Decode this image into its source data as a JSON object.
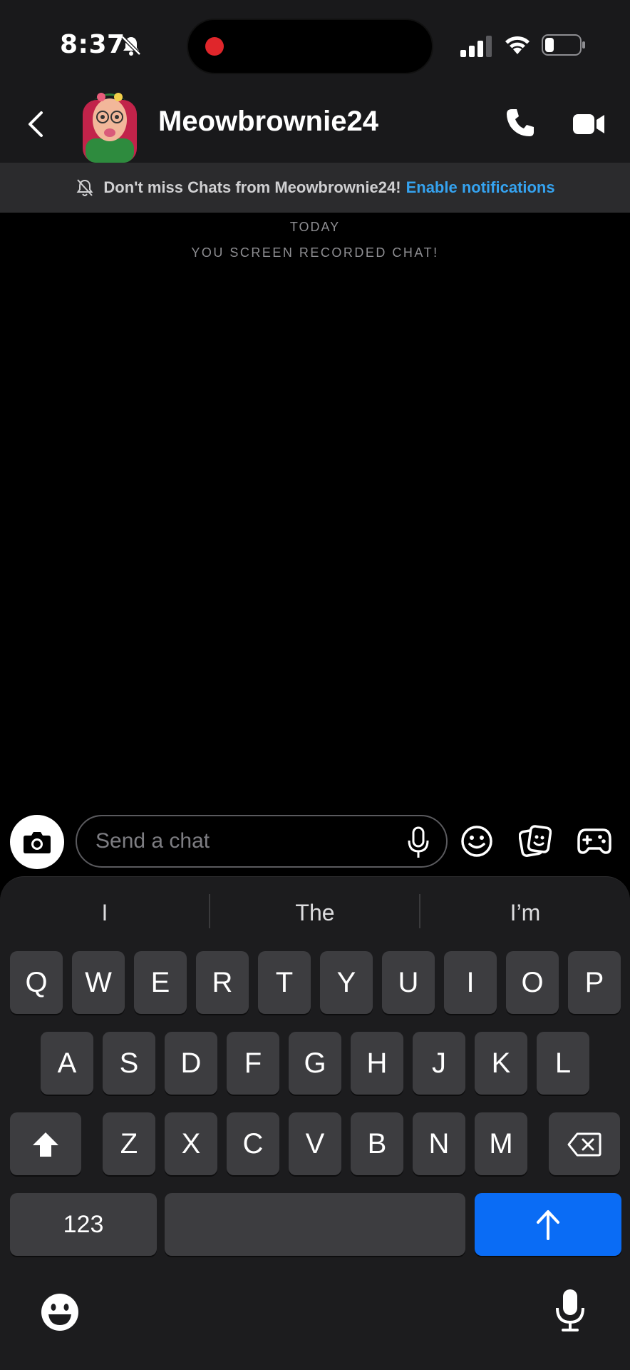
{
  "status_bar": {
    "time": "8:37"
  },
  "header": {
    "contact_name": "Meowbrownie24"
  },
  "banner": {
    "text": "Don't miss Chats from Meowbrownie24!",
    "link": "Enable notifications"
  },
  "chat": {
    "day_label": "TODAY",
    "system_message": "YOU SCREEN RECORDED CHAT!"
  },
  "input": {
    "placeholder": "Send a chat",
    "value": ""
  },
  "keyboard": {
    "suggestions": [
      "I",
      "The",
      "I’m"
    ],
    "row1": [
      "Q",
      "W",
      "E",
      "R",
      "T",
      "Y",
      "U",
      "I",
      "O",
      "P"
    ],
    "row2": [
      "A",
      "S",
      "D",
      "F",
      "G",
      "H",
      "J",
      "K",
      "L"
    ],
    "row3": [
      "Z",
      "X",
      "C",
      "V",
      "B",
      "N",
      "M"
    ],
    "numbers_key": "123"
  },
  "colors": {
    "accent_link": "#35a3f0",
    "return_key": "#0a6cf5",
    "record_dot": "#e0262b"
  },
  "icons": [
    "silent-bell-icon",
    "signal-icon",
    "wifi-icon",
    "battery-icon",
    "back-chevron-icon",
    "phone-icon",
    "video-camera-icon",
    "bell-slash-icon",
    "camera-icon",
    "microphone-icon",
    "emoji-icon",
    "sticker-icon",
    "game-controller-icon",
    "shift-icon",
    "backspace-icon",
    "send-arrow-icon"
  ]
}
